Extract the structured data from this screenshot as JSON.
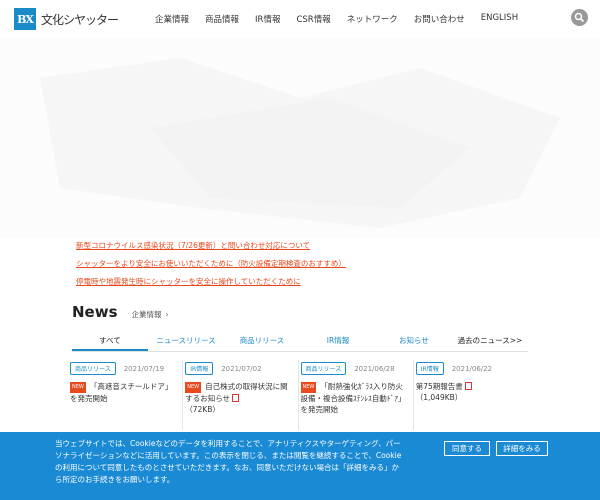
{
  "header": {
    "logo_mark": "BX",
    "logo_text": "文化シヤッター",
    "nav": [
      "企業情報",
      "商品情報",
      "IR情報",
      "CSR情報",
      "ネットワーク",
      "お問い合わせ",
      "ENGLISH"
    ],
    "search_icon": "search-icon"
  },
  "notices": [
    "新型コロナウイルス感染状況（7/26更新）と問い合わせ対応について",
    "シャッターをより安全にお使いいただくために（防火設備定期検査のおすすめ）",
    "停電時や地震発生時にシャッターを安全に操作していただくために"
  ],
  "news": {
    "title": "News",
    "sub_link": "企業情報",
    "tabs": [
      "すべて",
      "ニュースリリース",
      "商品リリース",
      "IR情報",
      "お知らせ",
      "過去のニュース>>"
    ],
    "cards": [
      {
        "tag": "商品リリース",
        "date": "2021/07/19",
        "new": "NEW",
        "text": "「高遮音スチールドア」を発売開始"
      },
      {
        "tag": "IR情報",
        "date": "2021/07/02",
        "new": "NEW",
        "text": "自己株式の取得状況に関するお知らせ",
        "size": "（72KB）"
      },
      {
        "tag": "商品リリース",
        "date": "2021/06/28",
        "new": "NEW",
        "text": "「耐熱強化ｶﾞﾗｽ入り防火設備・複合設備ｽﾃﾝﾚｽ自動ﾄﾞｱ」を発売開始"
      },
      {
        "tag": "IR情報",
        "date": "2021/06/22",
        "text": "第75期報告書",
        "size": "（1,049KB）"
      }
    ]
  },
  "cookie": {
    "text": "当ウェブサイトでは、Cookieなどのデータを利用することで、アナリティクスやターゲティング、パーソナライゼーションなどに活用しています。この表示を閉じる、または閲覧を継続することで、Cookieの利用について同意したものとさせていただきます。なお、同意いただけない場合は「詳細をみる」から所定のお手続きをお願いします。",
    "agree_label": "同意する",
    "details_label": "詳細をみる"
  },
  "colors": {
    "accent": "#1a8ac8",
    "notice": "#e8491d",
    "cookie_bg": "#1a8ad4"
  }
}
